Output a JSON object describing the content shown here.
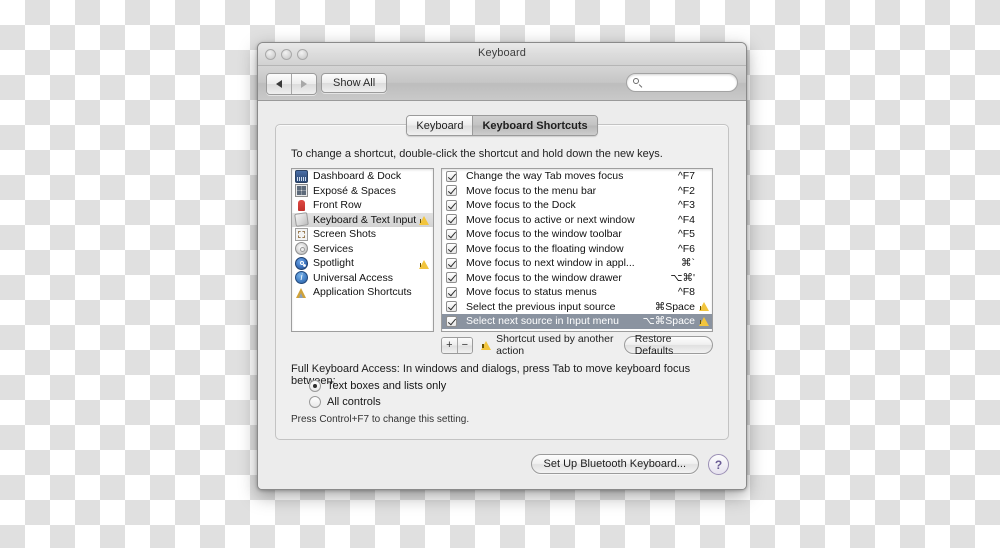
{
  "window": {
    "title": "Keyboard",
    "traffic_lights": [
      "close",
      "minimize",
      "zoom"
    ]
  },
  "toolbar": {
    "back_label": "◀",
    "forward_label": "▶",
    "show_all_label": "Show All",
    "search_value": "",
    "search_placeholder": ""
  },
  "tabs": [
    {
      "label": "Keyboard",
      "selected": false
    },
    {
      "label": "Keyboard Shortcuts",
      "selected": true
    }
  ],
  "pane": {
    "hint": "To change a shortcut, double-click the shortcut and hold down the new keys."
  },
  "categories": [
    {
      "label": "Dashboard & Dock",
      "icon": "dashboard-icon",
      "selected": false,
      "warning": false
    },
    {
      "label": "Exposé & Spaces",
      "icon": "expose-icon",
      "selected": false,
      "warning": false
    },
    {
      "label": "Front Row",
      "icon": "front-row-icon",
      "selected": false,
      "warning": false
    },
    {
      "label": "Keyboard & Text Input",
      "icon": "keyboard-icon",
      "selected": true,
      "warning": true
    },
    {
      "label": "Screen Shots",
      "icon": "screenshot-icon",
      "selected": false,
      "warning": false
    },
    {
      "label": "Services",
      "icon": "services-icon",
      "selected": false,
      "warning": false
    },
    {
      "label": "Spotlight",
      "icon": "spotlight-icon",
      "selected": false,
      "warning": true
    },
    {
      "label": "Universal Access",
      "icon": "universal-access-icon",
      "selected": false,
      "warning": false
    },
    {
      "label": "Application Shortcuts",
      "icon": "application-shortcuts-icon",
      "selected": false,
      "warning": false
    }
  ],
  "shortcuts": [
    {
      "name": "Change the way Tab moves focus",
      "key": "^F7",
      "checked": true,
      "selected": false,
      "warning": false
    },
    {
      "name": "Move focus to the menu bar",
      "key": "^F2",
      "checked": true,
      "selected": false,
      "warning": false
    },
    {
      "name": "Move focus to the Dock",
      "key": "^F3",
      "checked": true,
      "selected": false,
      "warning": false
    },
    {
      "name": "Move focus to active or next window",
      "key": "^F4",
      "checked": true,
      "selected": false,
      "warning": false
    },
    {
      "name": "Move focus to the window toolbar",
      "key": "^F5",
      "checked": true,
      "selected": false,
      "warning": false
    },
    {
      "name": "Move focus to the floating window",
      "key": "^F6",
      "checked": true,
      "selected": false,
      "warning": false
    },
    {
      "name": "Move focus to next window in appl...",
      "key": "⌘`",
      "checked": true,
      "selected": false,
      "warning": false
    },
    {
      "name": "Move focus to the window drawer",
      "key": "⌥⌘'",
      "checked": true,
      "selected": false,
      "warning": false
    },
    {
      "name": "Move focus to status menus",
      "key": "^F8",
      "checked": true,
      "selected": false,
      "warning": false
    },
    {
      "name": "Select the previous input source",
      "key": "⌘Space",
      "checked": true,
      "selected": false,
      "warning": true
    },
    {
      "name": "Select next source in Input menu",
      "key": "⌥⌘Space",
      "checked": true,
      "selected": true,
      "warning": true
    }
  ],
  "list_toolbar": {
    "add_label": "+",
    "remove_label": "−",
    "warning_text": "Shortcut used by another action",
    "restore_label": "Restore Defaults"
  },
  "full_keyboard_access": {
    "title": "Full Keyboard Access: In windows and dialogs, press Tab to move keyboard focus between:",
    "options": [
      {
        "label": "Text boxes and lists only",
        "selected": true
      },
      {
        "label": "All controls",
        "selected": false
      }
    ],
    "note": "Press Control+F7 to change this setting."
  },
  "footer": {
    "bluetooth_label": "Set Up Bluetooth Keyboard...",
    "help_label": "?"
  },
  "colors": {
    "selection_inactive": "#8a93a0",
    "warning_yellow": "#f2c53d",
    "window_bg": "#ececec",
    "help_accent": "#6a5c96"
  }
}
